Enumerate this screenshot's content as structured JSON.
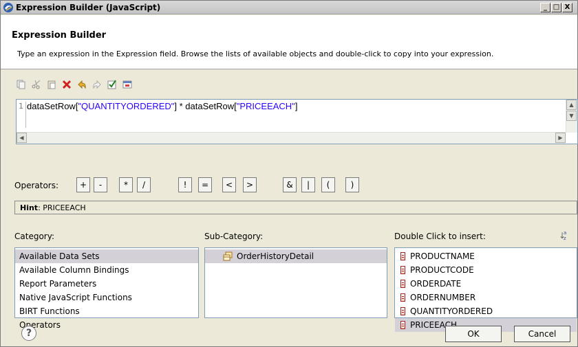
{
  "window": {
    "title": "Expression Builder (JavaScript)",
    "minimize": "_",
    "maximize": "□",
    "close": "X"
  },
  "header": {
    "title": "Expression Builder",
    "description": "Type an expression in the Expression field. Browse the lists of available objects and double-click to copy into your expression."
  },
  "toolbar": {
    "icons": [
      "copy-icon",
      "cut-icon",
      "paste-icon",
      "delete-icon",
      "undo-icon",
      "redo-icon",
      "validate-icon",
      "save-icon"
    ]
  },
  "editor": {
    "line_number": "1",
    "code_part1": "dataSetRow[",
    "code_str1": "\"QUANTITYORDERED\"",
    "code_part2": "] * dataSetRow[",
    "code_str2": "\"PRICEEACH\"",
    "code_part3": "]"
  },
  "operators": {
    "label": "Operators:",
    "buttons": [
      "+",
      "-",
      "*",
      "/",
      "!",
      "=",
      "<",
      ">",
      "&",
      "|",
      "(",
      ")"
    ]
  },
  "hint": {
    "label": "Hint",
    "value": ": PRICEEACH"
  },
  "category": {
    "label": "Category:",
    "items": [
      "Available Data Sets",
      "Available Column Bindings",
      "Report Parameters",
      "Native JavaScript Functions",
      "BIRT Functions",
      "Operators"
    ],
    "selected": "Available Data Sets"
  },
  "subcategory": {
    "label": "Sub-Category:",
    "items": [
      "OrderHistoryDetail"
    ]
  },
  "insert": {
    "label": "Double Click to insert:",
    "sort_icon": "sort-az-icon",
    "items": [
      "PRODUCTNAME",
      "PRODUCTCODE",
      "ORDERDATE",
      "ORDERNUMBER",
      "QUANTITYORDERED",
      "PRICEEACH"
    ],
    "selected": "PRICEEACH"
  },
  "buttons": {
    "help": "?",
    "ok": "OK",
    "cancel": "Cancel"
  }
}
